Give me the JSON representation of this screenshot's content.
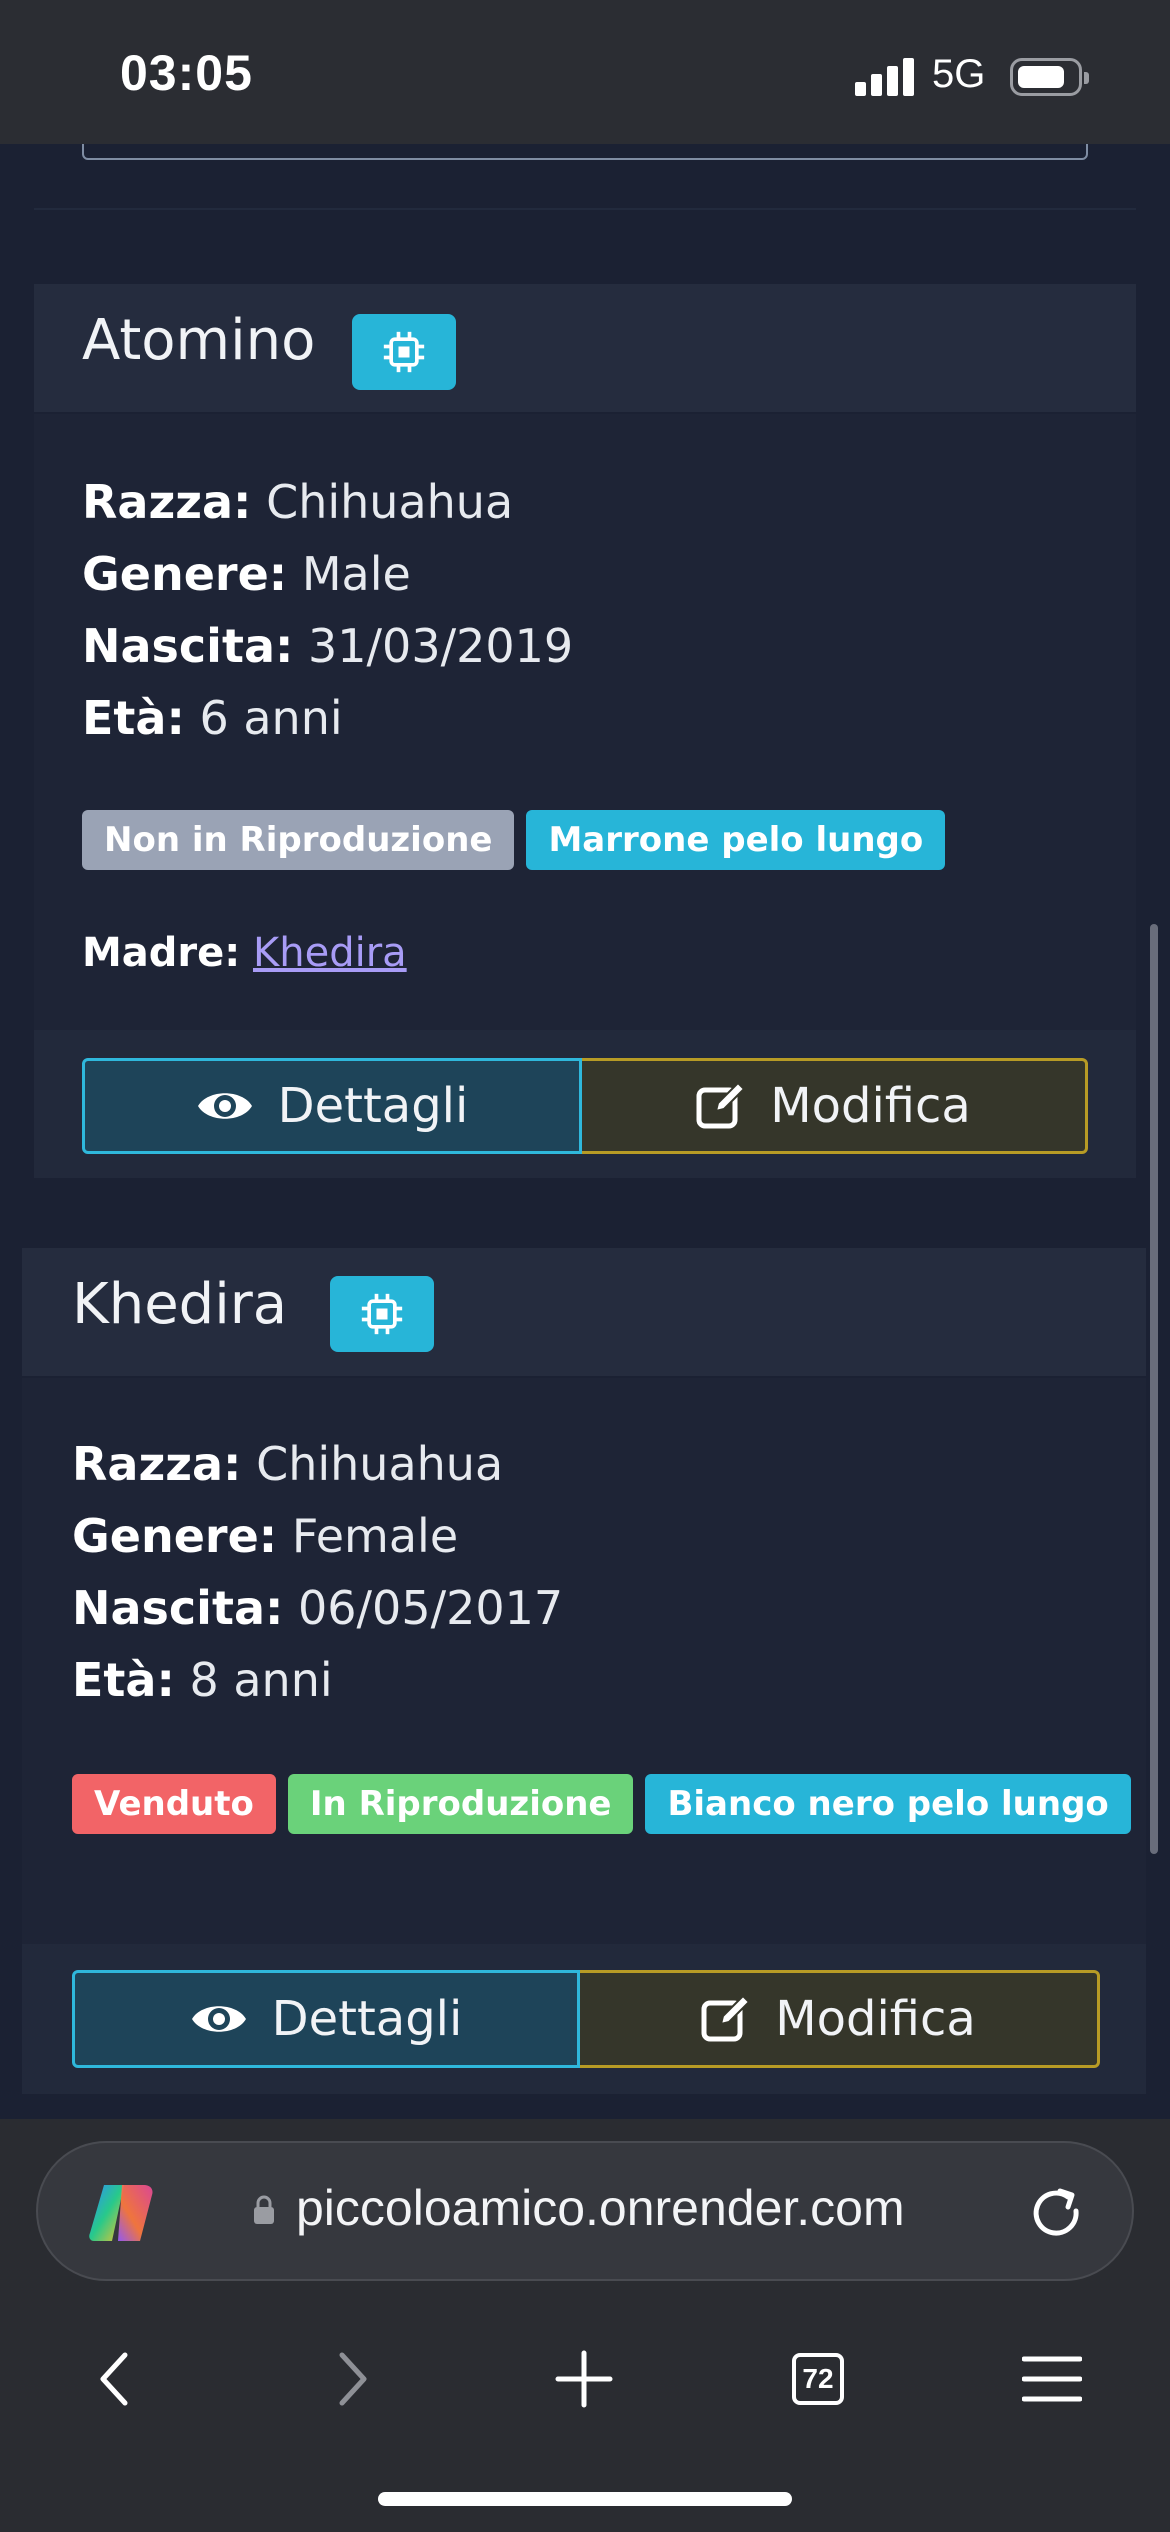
{
  "status_bar": {
    "time": "03:05",
    "network": "5G"
  },
  "dogs": [
    {
      "name": "Atomino",
      "info": [
        {
          "label": "Razza:",
          "value": "Chihuahua"
        },
        {
          "label": "Genere:",
          "value": "Male"
        },
        {
          "label": "Nascita:",
          "value": "31/03/2019"
        },
        {
          "label": "Età:",
          "value": "6 anni"
        }
      ],
      "tags": [
        {
          "text": "Non in Riproduzione",
          "color": "#9aa3b5"
        },
        {
          "text": "Marrone pelo lungo",
          "color": "#27b5d8"
        }
      ],
      "mother_label": "Madre:",
      "mother_name": "Khedira",
      "details_label": "Dettagli",
      "edit_label": "Modifica"
    },
    {
      "name": "Khedira",
      "info": [
        {
          "label": "Razza:",
          "value": "Chihuahua"
        },
        {
          "label": "Genere:",
          "value": "Female"
        },
        {
          "label": "Nascita:",
          "value": "06/05/2017"
        },
        {
          "label": "Età:",
          "value": "8 anni"
        }
      ],
      "tags": [
        {
          "text": "Venduto",
          "color": "#f26467"
        },
        {
          "text": "In Riproduzione",
          "color": "#6ad27a"
        },
        {
          "text": "Bianco nero pelo lungo",
          "color": "#27b5d8"
        }
      ],
      "details_label": "Dettagli",
      "edit_label": "Modifica"
    }
  ],
  "browser": {
    "url": "piccoloamico.onrender.com",
    "tab_count": "72",
    "icons": [
      "copilot-icon",
      "lock-icon",
      "reload-icon",
      "back-icon",
      "forward-icon",
      "new-tab-icon",
      "tabs-icon",
      "menu-icon"
    ]
  }
}
